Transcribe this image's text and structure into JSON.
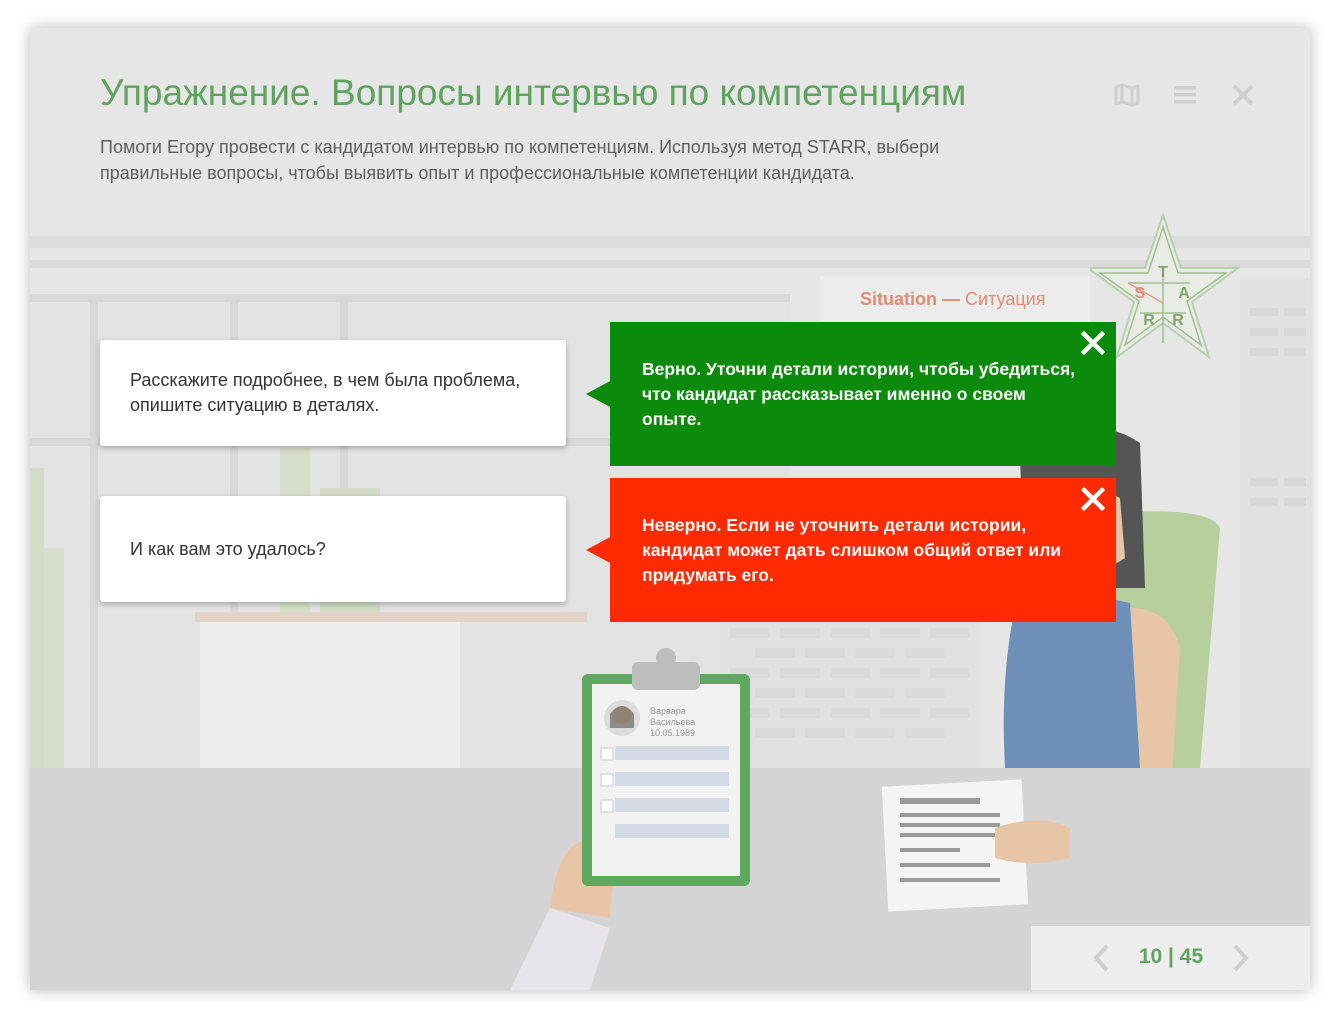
{
  "header": {
    "title": "Упражнение. Вопросы интервью по компетенциям",
    "intro": "Помоги Егору провести с кандидатом интервью по компетенциям. Используя метод STARR, выбери правильные вопросы, чтобы выявить опыт и профессиональные компетенции кандидата.",
    "icons": [
      "map-icon",
      "menu-icon",
      "close-icon"
    ]
  },
  "stage": {
    "situation_en": "Situation",
    "situation_sep": " — ",
    "situation_ru": "Ситуация",
    "star_letters": [
      "T",
      "S",
      "A",
      "R",
      "R"
    ]
  },
  "questions": [
    {
      "text": "Расскажите подробнее, в чем была проблема, опишите ситуацию в деталях."
    },
    {
      "text": "И как вам это удалось?"
    }
  ],
  "feedback": [
    {
      "status": "correct",
      "color": "#0c8a0c",
      "text": "Верно. Уточни детали истории, чтобы убедиться, что кандидат рассказывает именно о своем опыте."
    },
    {
      "status": "incorrect",
      "color": "#ff2a00",
      "text": "Неверно. Если не уточнить детали истории, кандидат может дать слишком общий ответ или придумать его."
    }
  ],
  "clipboard": {
    "name_first": "Варвара",
    "name_last": "Васильева",
    "date": "10.05.1989"
  },
  "pager": {
    "current": "10",
    "separator": " | ",
    "total": "45"
  },
  "colors": {
    "accent": "#5ea35e",
    "correct": "#0c8a0c",
    "incorrect": "#ff2a00",
    "situation": "#e28a72"
  }
}
